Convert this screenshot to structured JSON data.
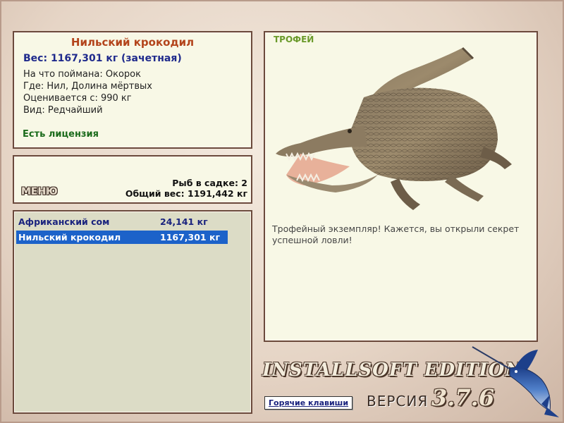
{
  "info": {
    "title": "Нильский крокодил",
    "weight": "Вес: 1167,301 кг (зачетная)",
    "bait": "На что поймана: Окорок",
    "location": "Где: Нил, Долина мёртвых",
    "rated_from": "Оценивается с: 990 кг",
    "kind": "Вид: Редчайший",
    "license": "Есть лицензия"
  },
  "cage": {
    "menu_label": "МЕНЮ",
    "fish_count": "Рыб в садке: 2",
    "total_weight": "Общий вес: 1191,442 кг"
  },
  "catch_list": [
    {
      "name": "Африканский сом",
      "weight": "24,141 кг",
      "selected": false
    },
    {
      "name": "Нильский крокодил",
      "weight": "1167,301 кг",
      "selected": true
    }
  ],
  "trophy": {
    "label": "ТРОФЕЙ",
    "description": "Трофейный экземпляр! Кажется, вы открыли секрет успешной ловли!"
  },
  "footer": {
    "hotkeys_label": "Горячие клавиши",
    "edition": "INSTALLSOFT EDITION",
    "version_label": "ВЕРСИЯ",
    "version_number": "3.7.6"
  },
  "colors": {
    "title": "#b3441b",
    "weight": "#1f2a8c",
    "license": "#1b6b1b",
    "selection": "#1c62c9",
    "trophy_label": "#6a9a2a",
    "panel_bg": "#f8f8e6",
    "panel_border": "#6b4a3c"
  },
  "icons": [
    "crocodile-image",
    "marlin-logo"
  ]
}
